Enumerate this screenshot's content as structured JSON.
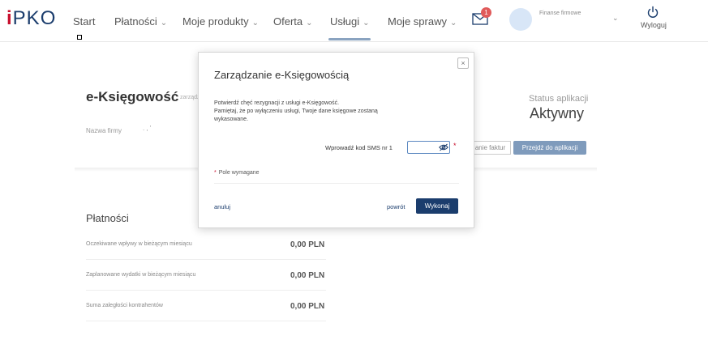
{
  "header": {
    "logo_prefix": "i",
    "logo_main": "PKO",
    "nav": [
      {
        "label": "Start",
        "has_menu": false
      },
      {
        "label": "Płatności",
        "has_menu": true
      },
      {
        "label": "Moje produkty",
        "has_menu": true
      },
      {
        "label": "Oferta",
        "has_menu": true
      },
      {
        "label": "Usługi",
        "has_menu": true
      },
      {
        "label": "Moje sprawy",
        "has_menu": true
      }
    ],
    "chevron": "⌄",
    "mail_badge": "1",
    "profile_name": "Finanse firmowe",
    "profile_chevron": "⌄",
    "logout_label": "Wyloguj"
  },
  "page": {
    "title": "e-Księgowość",
    "subtitle": "zarządz",
    "company_label": "Nazwa firmy",
    "company_value": ".  ,  '",
    "status_label": "Status aplikacji",
    "status_value": "Aktywny",
    "ghost_button": "anie faktur",
    "go_app_button": "Przejdź do aplikacji"
  },
  "payments": {
    "title": "Płatności",
    "rows": [
      {
        "label": "Oczekiwane wpływy w bieżącym miesiącu",
        "value": "0,00 PLN"
      },
      {
        "label": "Zaplanowane wydatki w bieżącym miesiącu",
        "value": "0,00 PLN"
      },
      {
        "label": "Suma zaległości kontrahentów",
        "value": "0,00 PLN"
      }
    ]
  },
  "modal": {
    "close_glyph": "×",
    "title": "Zarządzanie e-Księgowością",
    "message_lines": [
      "Potwierdź chęć rezygnacji z usługi e-Księgowość.",
      "Pamiętaj, że po wyłączeniu usługi, Twoje dane księgowe zostaną",
      "wykasowane."
    ],
    "sms_label": "Wprowadź kod SMS nr 1",
    "sms_value": "",
    "required_star": "*",
    "required_note": "Pole wymagane",
    "cancel_label": "anuluj",
    "back_label": "powrót",
    "execute_label": "Wykonaj"
  },
  "colors": {
    "brand_navy": "#1b3d6d",
    "accent_red": "#c8102e",
    "button_muted": "#7f9bbc"
  }
}
